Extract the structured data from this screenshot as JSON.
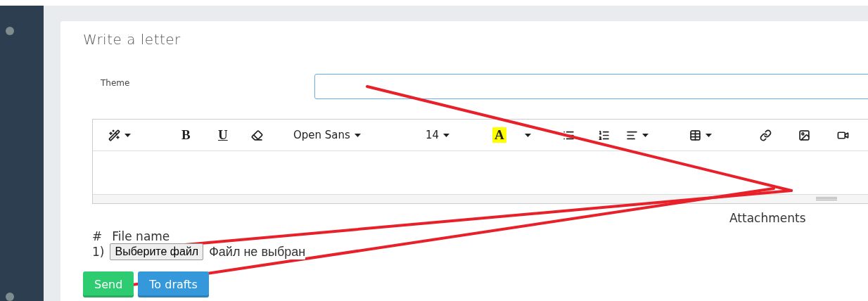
{
  "title": "Write a letter",
  "theme": {
    "label": "Theme"
  },
  "toolbar": [
    {
      "kind": "magic"
    },
    {
      "kind": "bold",
      "label": "B"
    },
    {
      "kind": "underline",
      "label": "U"
    },
    {
      "kind": "eraser"
    },
    {
      "kind": "font",
      "label": "Open Sans"
    },
    {
      "kind": "size",
      "label": "14"
    },
    {
      "kind": "color",
      "label": "A"
    },
    {
      "kind": "ul"
    },
    {
      "kind": "ol"
    },
    {
      "kind": "align"
    },
    {
      "kind": "table"
    },
    {
      "kind": "link"
    },
    {
      "kind": "image"
    },
    {
      "kind": "video"
    }
  ],
  "attachments": {
    "heading": "Attachments",
    "columns": [
      "#",
      "File name"
    ],
    "rows": [
      {
        "index": "1)",
        "button": "Выберите файл",
        "status": "Файл не выбран"
      }
    ]
  },
  "buttons": [
    {
      "label": "Send",
      "kind": "success"
    },
    {
      "label": "To drafts",
      "kind": "primary"
    }
  ]
}
